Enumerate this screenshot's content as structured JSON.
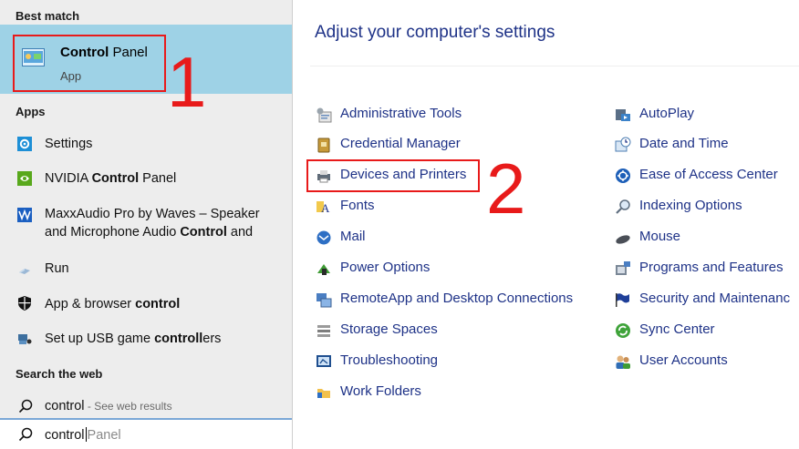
{
  "search_panel": {
    "best_match_header": "Best match",
    "best_match": {
      "title_bold": "Control",
      "title_rest": " Panel",
      "subtitle": "App"
    },
    "apps_header": "Apps",
    "apps": [
      {
        "icon": "settings-gear-icon",
        "pre": "Settings",
        "bold": "",
        "post": ""
      },
      {
        "icon": "nvidia-icon",
        "pre": "NVIDIA ",
        "bold": "Control",
        "post": " Panel"
      },
      {
        "icon": "maxxaudio-icon",
        "line1": "MaxxAudio Pro by Waves – Speaker",
        "line2_pre": "and Microphone Audio ",
        "line2_bold": "Control",
        "line2_post": " and"
      },
      {
        "icon": "run-icon",
        "pre": "Run",
        "bold": "",
        "post": ""
      },
      {
        "icon": "shield-icon",
        "pre": "App & browser ",
        "bold": "control",
        "post": ""
      },
      {
        "icon": "gamepad-icon",
        "pre": "Set up USB game ",
        "bold": "controll",
        "post": "ers"
      }
    ],
    "web_header": "Search the web",
    "web_result": {
      "query": "control",
      "hint": " - See web results"
    },
    "search_box": {
      "typed": "control",
      "suggestion": "Panel"
    }
  },
  "annotations": {
    "one": "1",
    "two": "2"
  },
  "control_panel": {
    "title": "Adjust your computer's settings",
    "left_column": [
      "Administrative Tools",
      "Credential Manager",
      "Devices and Printers",
      "Fonts",
      "Mail",
      "Power Options",
      "RemoteApp and Desktop Connections",
      "Storage Spaces",
      "Troubleshooting",
      "Work Folders"
    ],
    "right_column": [
      "AutoPlay",
      "Date and Time",
      "Ease of Access Center",
      "Indexing Options",
      "Mouse",
      "Programs and Features",
      "Security and Maintenanc",
      "Sync Center",
      "User Accounts"
    ]
  },
  "colors": {
    "link": "#1e3287",
    "highlight": "#9ed2e6",
    "annotation_red": "#e81a1a",
    "panel_bg": "#ededed"
  }
}
